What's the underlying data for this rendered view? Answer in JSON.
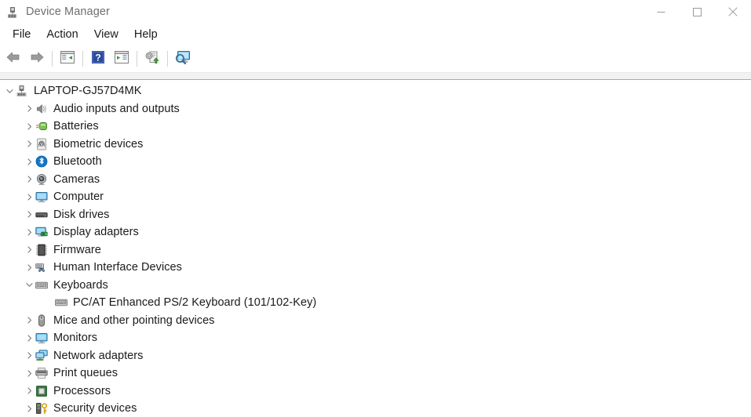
{
  "window": {
    "title": "Device Manager",
    "icon": "device-manager-icon",
    "controls": [
      {
        "name": "minimize",
        "glyph": "—"
      },
      {
        "name": "maximize",
        "glyph": "□"
      },
      {
        "name": "close",
        "glyph": "✕"
      }
    ]
  },
  "menubar": {
    "items": [
      {
        "label": "File"
      },
      {
        "label": "Action"
      },
      {
        "label": "View"
      },
      {
        "label": "Help"
      }
    ]
  },
  "toolbar": {
    "buttons": [
      {
        "name": "back-button",
        "icon": "back-arrow-icon"
      },
      {
        "name": "forward-button",
        "icon": "forward-arrow-icon"
      },
      {
        "name": "separator-1",
        "icon": "separator"
      },
      {
        "name": "show-hide-console-tree-button",
        "icon": "console-tree-icon"
      },
      {
        "name": "separator-2",
        "icon": "separator"
      },
      {
        "name": "help-button",
        "icon": "help-question-icon"
      },
      {
        "name": "properties-button",
        "icon": "properties-icon"
      },
      {
        "name": "separator-3",
        "icon": "separator"
      },
      {
        "name": "update-driver-button",
        "icon": "update-driver-icon"
      },
      {
        "name": "separator-4",
        "icon": "separator"
      },
      {
        "name": "scan-for-hardware-changes-button",
        "icon": "scan-hardware-icon"
      }
    ]
  },
  "tree": {
    "nodes": [
      {
        "label": "LAPTOP-GJ57D4MK",
        "level": 0,
        "state": "expanded",
        "icon": "computer-root-icon"
      },
      {
        "label": "Audio inputs and outputs",
        "level": 1,
        "state": "collapsed",
        "icon": "speaker-icon"
      },
      {
        "label": "Batteries",
        "level": 1,
        "state": "collapsed",
        "icon": "battery-icon"
      },
      {
        "label": "Biometric devices",
        "level": 1,
        "state": "collapsed",
        "icon": "fingerprint-icon"
      },
      {
        "label": "Bluetooth",
        "level": 1,
        "state": "collapsed",
        "icon": "bluetooth-icon"
      },
      {
        "label": "Cameras",
        "level": 1,
        "state": "collapsed",
        "icon": "camera-icon"
      },
      {
        "label": "Computer",
        "level": 1,
        "state": "collapsed",
        "icon": "monitor-icon"
      },
      {
        "label": "Disk drives",
        "level": 1,
        "state": "collapsed",
        "icon": "disk-drive-icon"
      },
      {
        "label": "Display adapters",
        "level": 1,
        "state": "collapsed",
        "icon": "display-adapter-icon"
      },
      {
        "label": "Firmware",
        "level": 1,
        "state": "collapsed",
        "icon": "chip-icon"
      },
      {
        "label": "Human Interface Devices",
        "level": 1,
        "state": "collapsed",
        "icon": "hid-icon"
      },
      {
        "label": "Keyboards",
        "level": 1,
        "state": "expanded",
        "icon": "keyboard-icon"
      },
      {
        "label": "PC/AT Enhanced PS/2 Keyboard (101/102-Key)",
        "level": 2,
        "state": "leaf",
        "icon": "keyboard-icon"
      },
      {
        "label": "Mice and other pointing devices",
        "level": 1,
        "state": "collapsed",
        "icon": "mouse-icon"
      },
      {
        "label": "Monitors",
        "level": 1,
        "state": "collapsed",
        "icon": "monitor-icon"
      },
      {
        "label": "Network adapters",
        "level": 1,
        "state": "collapsed",
        "icon": "network-adapter-icon"
      },
      {
        "label": "Print queues",
        "level": 1,
        "state": "collapsed",
        "icon": "printer-icon"
      },
      {
        "label": "Processors",
        "level": 1,
        "state": "collapsed",
        "icon": "processor-icon"
      },
      {
        "label": "Security devices",
        "level": 1,
        "state": "collapsed",
        "icon": "security-key-icon"
      }
    ]
  },
  "colors": {
    "window_bg": "#ffffff",
    "title_text": "#6e6e6e",
    "body_text": "#1a1a1a",
    "chevron": "#767676",
    "separator": "#a9a9a9",
    "accent_blue": "#0a84d8",
    "accent_green": "#3c9a28"
  }
}
